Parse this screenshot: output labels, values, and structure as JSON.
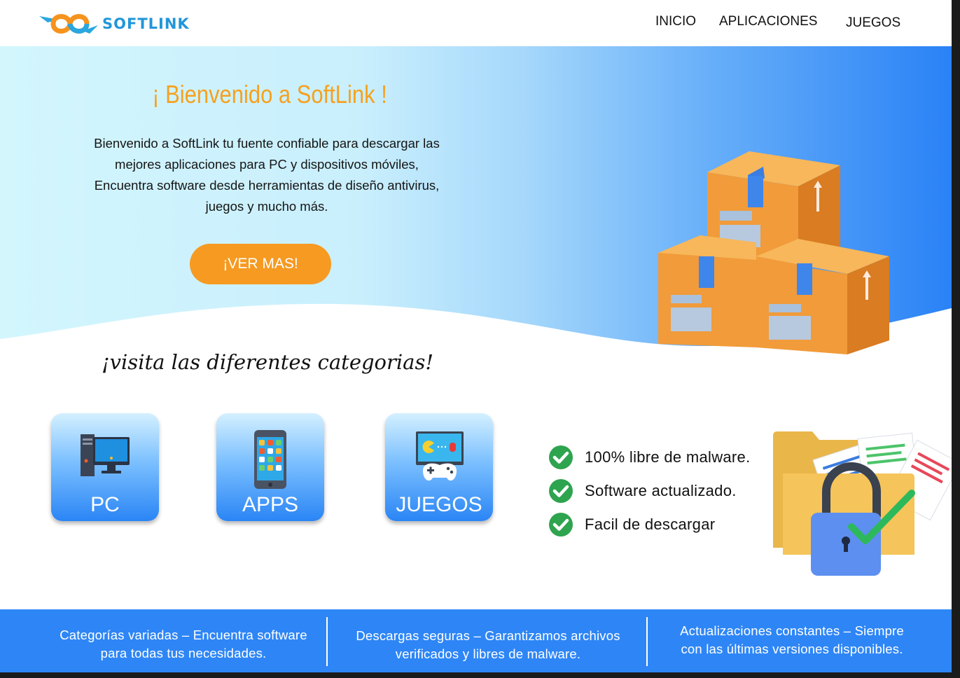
{
  "brand": {
    "name": "SOFTLINK"
  },
  "nav": {
    "items": [
      "INICIO",
      "APLICACIONES",
      "JUEGOS"
    ]
  },
  "hero": {
    "title": "¡ Bienvenido a SoftLink !",
    "lines": [
      "Bienvenido a SoftLink tu fuente confiable para descargar las",
      "mejores aplicaciones para PC y dispositivos móviles,",
      "Encuentra software desde herramientas de diseño antivirus,",
      "juegos y mucho más."
    ],
    "cta": "¡VER MAS!"
  },
  "categories": {
    "title": "¡visita las diferentes categorias!",
    "items": [
      "PC",
      "APPS",
      "JUEGOS"
    ]
  },
  "features": [
    "100% libre de malware.",
    "Software actualizado.",
    "Facil de descargar"
  ],
  "footer": {
    "columns": [
      [
        "Categorías variadas – Encuentra software",
        "para todas tus necesidades."
      ],
      [
        "Descargas seguras – Garantizamos archivos",
        "verificados y libres de malware."
      ],
      [
        "Actualizaciones constantes – Siempre",
        "con las últimas versiones disponibles."
      ]
    ]
  },
  "colors": {
    "accent": "#f69a22",
    "primary": "#2e86f6",
    "logo_blue": "#2196d8"
  }
}
